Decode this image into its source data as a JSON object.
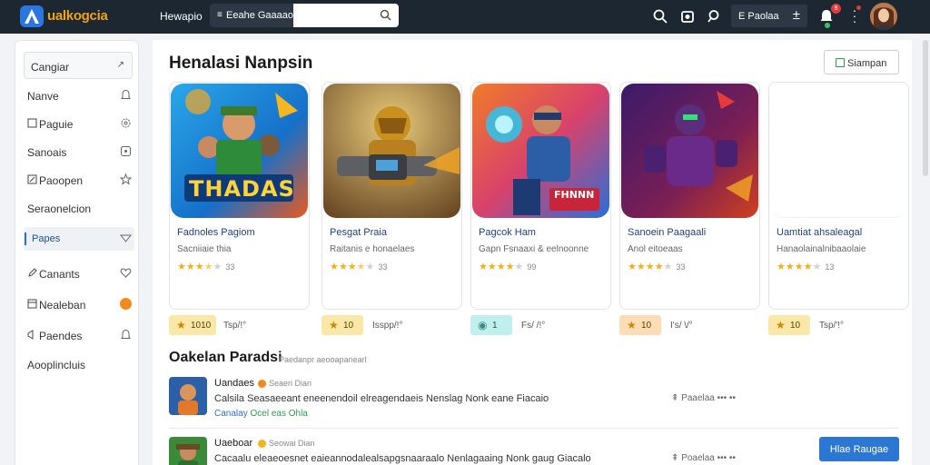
{
  "app": {
    "brand": "ualkogcia"
  },
  "topbar": {
    "nav_link": "Hewapio",
    "scope_label": "Eeahe Gaaaaohc",
    "search_placeholder": "",
    "pill_label": "E Paolaa"
  },
  "notification_badge": "9",
  "sidebar": {
    "header": "Cangiar",
    "items": [
      {
        "label": "Nanve",
        "right_icon": "bell-icon"
      },
      {
        "label": "Paguie",
        "left_icon": "square-icon",
        "right_icon": "gear-icon"
      },
      {
        "label": "Sanoais",
        "right_icon": "clock-icon"
      },
      {
        "label": "Paoopen",
        "left_icon": "edit-icon",
        "right_icon": "star-icon"
      },
      {
        "label": "Seraonelcion"
      },
      {
        "label": "Papes",
        "active": true,
        "right_icon": "filter-icon"
      },
      {
        "label": "Canants",
        "left_icon": "pen-icon",
        "right_icon": "heart-icon"
      },
      {
        "label": "Nealeban",
        "left_icon": "box-icon",
        "right_icon": "orange-dot"
      },
      {
        "label": "Paendes",
        "left_icon": "bell-outline-icon",
        "right_icon": "bell-icon"
      },
      {
        "label": "Aooplincluis"
      }
    ]
  },
  "main": {
    "section_title": "Henalasi Nanpsin",
    "share_label": "Siampan",
    "cards": [
      {
        "name": "Fadnoles Pagiom",
        "sub": "Sacniiaie thia",
        "stars": 3.5,
        "count": "33",
        "art_text": "THADAS"
      },
      {
        "name": "Pesgat Praia",
        "sub": "Raitanis e honaelaes",
        "stars": 3.5,
        "count": "33"
      },
      {
        "name": "Pagcok Ham",
        "sub": "Gapn Fsnaaxi & eelnoonne",
        "stars": 4,
        "count": "99",
        "art_text": "FHNNN"
      },
      {
        "name": "Sanoein Paagaali",
        "sub": "Anol eitoeaas",
        "stars": 4,
        "count": "33"
      },
      {
        "name": "Uamtiat ahsaleagal",
        "sub": "Hanaolainalnibaaolaie",
        "stars": 4,
        "count": "13"
      }
    ],
    "chips": [
      {
        "value": "1010",
        "meta": "Tsp/!°",
        "color": "#fbe7a8"
      },
      {
        "value": "10",
        "meta": "Isspp/!°",
        "color": "#fbe7a8"
      },
      {
        "value": "1",
        "meta": "Fs/ /!°",
        "color": "#bff0ee"
      },
      {
        "value": "10",
        "meta": "I's/ \\/°",
        "color": "#fdddb5"
      },
      {
        "value": "10",
        "meta": "Tsp/'!°",
        "color": "#fbe7a8"
      }
    ],
    "section2_title": "Oakelan Paradsi",
    "section2_sub": "Paedanpr aeooapanearl",
    "feed": [
      {
        "author": "Uandaes",
        "handle": "Seaeri Dian",
        "body": "Calsila Seasaeeant eneenendoil elreagendaeis Nenslag Nonk eane Fiacaio",
        "tag1": "Canalay",
        "tag2": "Ocel eas Ohla",
        "actions": "Paaelaa ••• ••"
      },
      {
        "author": "Uaeboar",
        "handle": "Seowai Dian",
        "body": "Cacaalu eleaeoesnet eaieannodalealsapgsnaaraalo Nenlagaaing Nonk gaug Giacalo",
        "actions": "Poaelaa ••• ••"
      }
    ],
    "cta_label": "Hlae Raugae"
  },
  "colors": {
    "topbar_bg": "#1d2731",
    "brand": "#f0a31a",
    "link_blue": "#1d3f8a",
    "star": "#f2b01e",
    "cta_bg": "#2b77d3",
    "accent_green": "#2e9a4a"
  }
}
